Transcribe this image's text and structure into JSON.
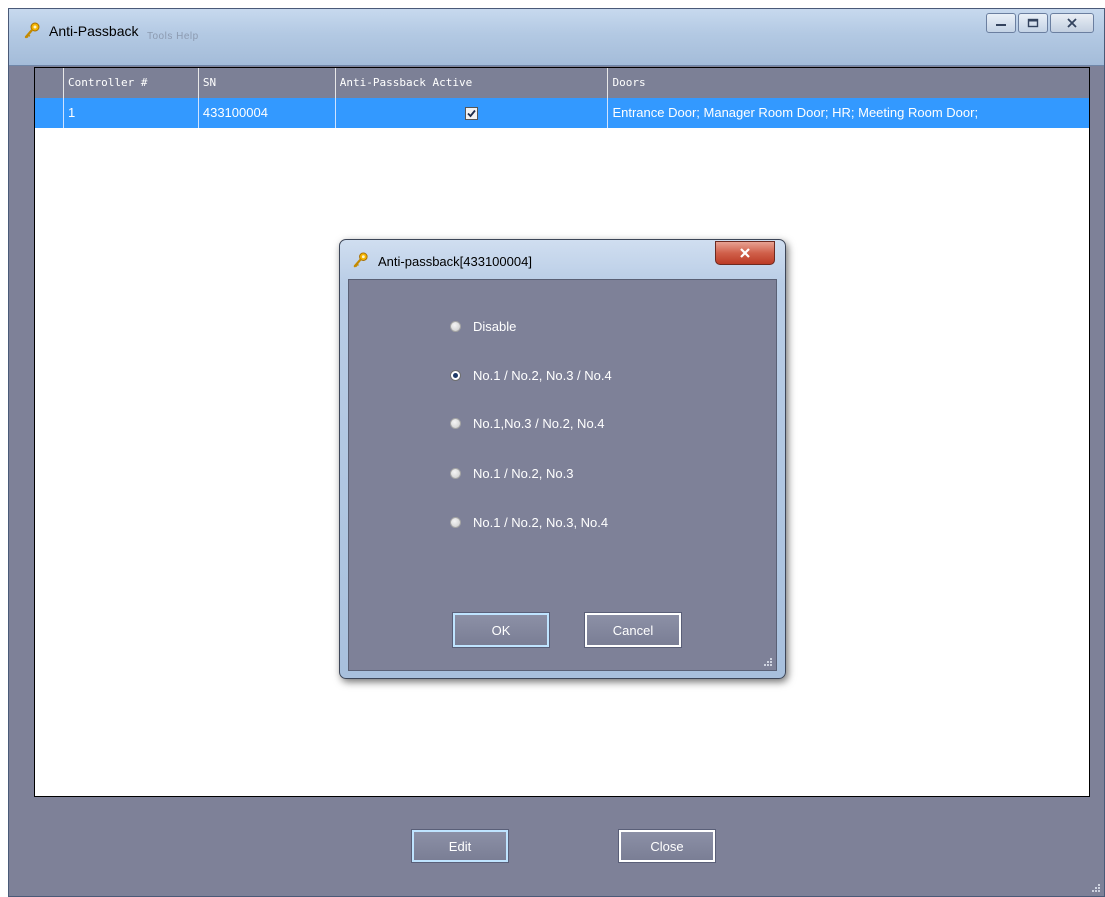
{
  "window": {
    "title": "Anti-Passback",
    "menu_ghost": "Tools    Help",
    "minimize_label": "minimize",
    "restore_label": "restore",
    "close_label": "close"
  },
  "grid": {
    "columns": [
      "",
      "Controller #",
      "SN",
      "Anti-Passback Active",
      "Doors"
    ],
    "rows": [
      {
        "controller": "1",
        "sn": "433100004",
        "active": true,
        "doors": "Entrance Door;  Manager Room Door;  HR;  Meeting Room Door;"
      }
    ]
  },
  "buttons": {
    "edit": "Edit",
    "close": "Close"
  },
  "dialog": {
    "title": "Anti-passback[433100004]",
    "options": [
      {
        "label": "Disable",
        "checked": false
      },
      {
        "label": "No.1 / No.2, No.3 / No.4",
        "checked": true
      },
      {
        "label": "No.1,No.3 / No.2, No.4",
        "checked": false
      },
      {
        "label": "No.1 / No.2, No.3",
        "checked": false
      },
      {
        "label": "No.1 / No.2, No.3, No.4",
        "checked": false
      }
    ],
    "ok": "OK",
    "cancel": "Cancel"
  },
  "colors": {
    "selection": "#3399ff",
    "panel": "#7e8198",
    "header": "#7c8096"
  }
}
